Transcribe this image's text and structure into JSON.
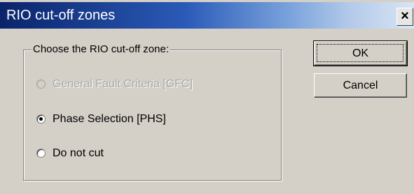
{
  "window": {
    "title": "RIO cut-off zones",
    "close_label": "×"
  },
  "group": {
    "legend": "Choose the RIO cut-off zone:",
    "options": [
      {
        "label": "General Fault Criteria [GFC]",
        "selected": false,
        "enabled": false
      },
      {
        "label": "Phase Selection [PHS]",
        "selected": true,
        "enabled": true
      },
      {
        "label": "Do not cut",
        "selected": false,
        "enabled": true
      }
    ]
  },
  "buttons": {
    "ok_label": "OK",
    "cancel_label": "Cancel"
  }
}
